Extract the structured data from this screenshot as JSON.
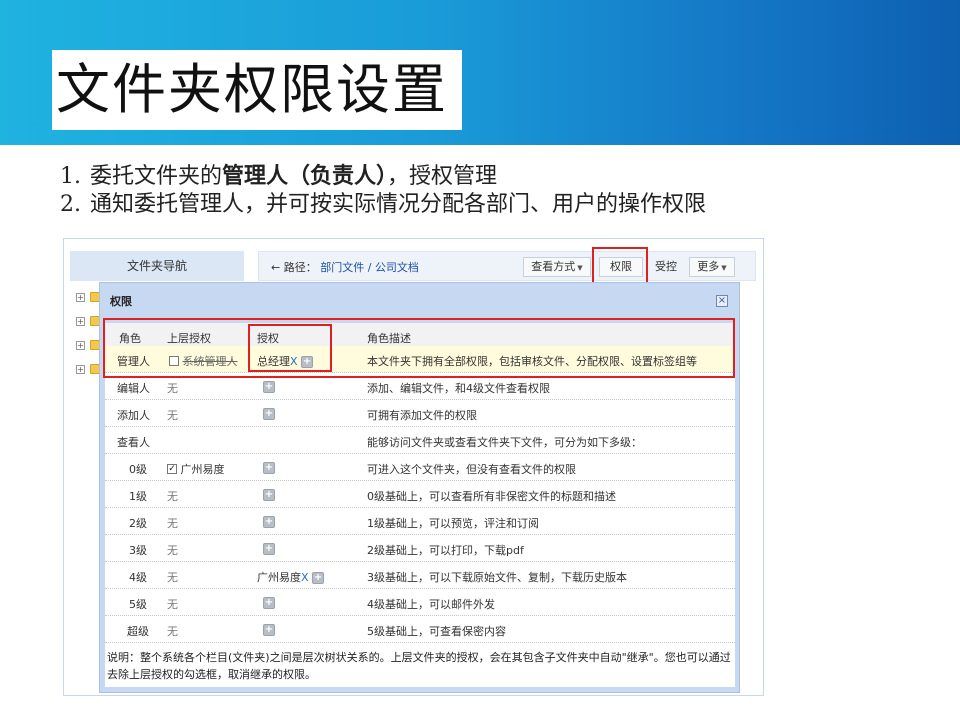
{
  "slide": {
    "title": "文件夹权限设置",
    "bullets": [
      {
        "num": "1.",
        "pre": "委托文件夹的",
        "bold": "管理人（负责人）",
        "post": "，授权管理"
      },
      {
        "num": "2.",
        "pre": "通知委托管理人，并可按实际情况分配各部门、用户的操作权限",
        "bold": "",
        "post": ""
      }
    ]
  },
  "app": {
    "nav_title": "文件夹导航",
    "tree_count": 4,
    "breadcrumb": {
      "arrow": "←",
      "label": "路径：",
      "path1": "部门文件",
      "sep": "/",
      "path2": "公司文档"
    },
    "toolbar": {
      "view_label": "查看方式",
      "perm_label": "权限",
      "monitor_label": "受控",
      "more_label": "更多"
    }
  },
  "dialog": {
    "title": "权限",
    "close": "×",
    "headers": {
      "role": "角色",
      "inherit": "上层授权",
      "grant": "授权",
      "desc": "角色描述"
    },
    "rows": [
      {
        "role": "管理人",
        "inherit": "系统管理人",
        "grant": "总经理",
        "desc": "本文件夹下拥有全部权限，包括审核文件、分配权限、设置标签组等"
      },
      {
        "role": "编辑人",
        "inherit": "无",
        "grant": "",
        "desc": "添加、编辑文件，和4级文件查看权限"
      },
      {
        "role": "添加人",
        "inherit": "无",
        "grant": "",
        "desc": "可拥有添加文件的权限"
      },
      {
        "role": "查看人",
        "inherit": "",
        "grant": "",
        "desc": "能够访问文件夹或查看文件夹下文件，可分为如下多级："
      },
      {
        "role": "0级",
        "inherit": "广州易度",
        "grant": "",
        "desc": "可进入这个文件夹，但没有查看文件的权限"
      },
      {
        "role": "1级",
        "inherit": "无",
        "grant": "",
        "desc": "0级基础上，可以查看所有非保密文件的标题和描述"
      },
      {
        "role": "2级",
        "inherit": "无",
        "grant": "",
        "desc": "1级基础上，可以预览，评注和订阅"
      },
      {
        "role": "3级",
        "inherit": "无",
        "grant": "",
        "desc": "2级基础上，可以打印，下载pdf"
      },
      {
        "role": "4级",
        "inherit": "无",
        "grant": "广州易度",
        "desc": "3级基础上，可以下载原始文件、复制，下载历史版本"
      },
      {
        "role": "5级",
        "inherit": "无",
        "grant": "",
        "desc": "4级基础上，可以邮件外发"
      },
      {
        "role": "超级",
        "inherit": "无",
        "grant": "",
        "desc": "5级基础上，可查看保密内容"
      }
    ],
    "remove_x": "X",
    "plus": "+",
    "check_mark": "✓",
    "note_line1": "说明：整个系统各个栏目(文件夹)之间是层次树状关系的。上层文件夹的授权，会在其包含子文件夹中自动\"继承\"。您也可以通过",
    "note_line2": "去除上层授权的勾选框，取消继承的权限。"
  },
  "colors": {
    "banner_start": "#1fb3e0",
    "banner_end": "#0e5fb0",
    "highlight_box": "#e0201f",
    "link": "#1a4fa8"
  }
}
